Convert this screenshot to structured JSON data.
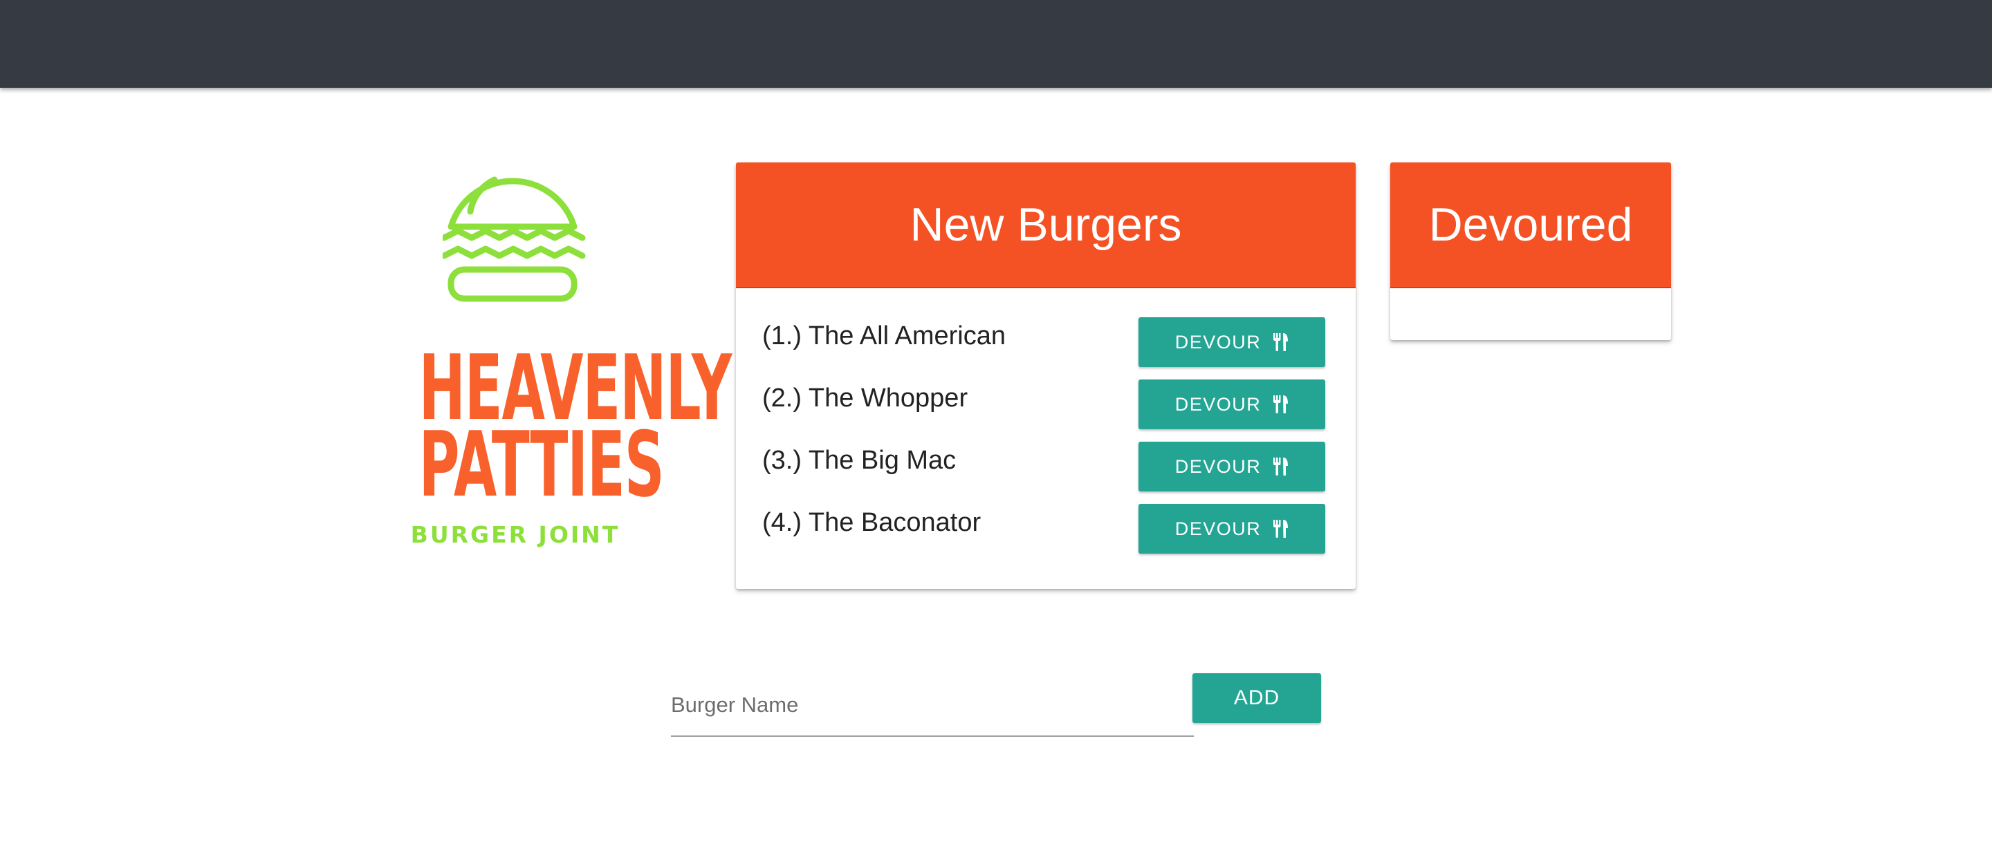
{
  "brand": {
    "name_line1": "HEAVENLY",
    "name_line2": "PATTIES",
    "tagline": "BURGER JOINT",
    "logo_icon": "burger-icon",
    "colors": {
      "navbar": "#363a43",
      "brand_orange": "#f8612b",
      "brand_green": "#8ddf3b",
      "card_header": "#f45125",
      "button_teal": "#24a594"
    }
  },
  "new_burgers": {
    "title": "New Burgers",
    "items": [
      {
        "label": "(1.) The All American",
        "button": "DEVOUR"
      },
      {
        "label": "(2.) The Whopper",
        "button": "DEVOUR"
      },
      {
        "label": "(3.) The Big Mac",
        "button": "DEVOUR"
      },
      {
        "label": "(4.) The Baconator",
        "button": "DEVOUR"
      }
    ],
    "button_icon": "utensils-icon"
  },
  "devoured": {
    "title": "Devoured",
    "items": []
  },
  "add_form": {
    "placeholder": "Burger Name",
    "value": "",
    "button_label": "ADD"
  }
}
